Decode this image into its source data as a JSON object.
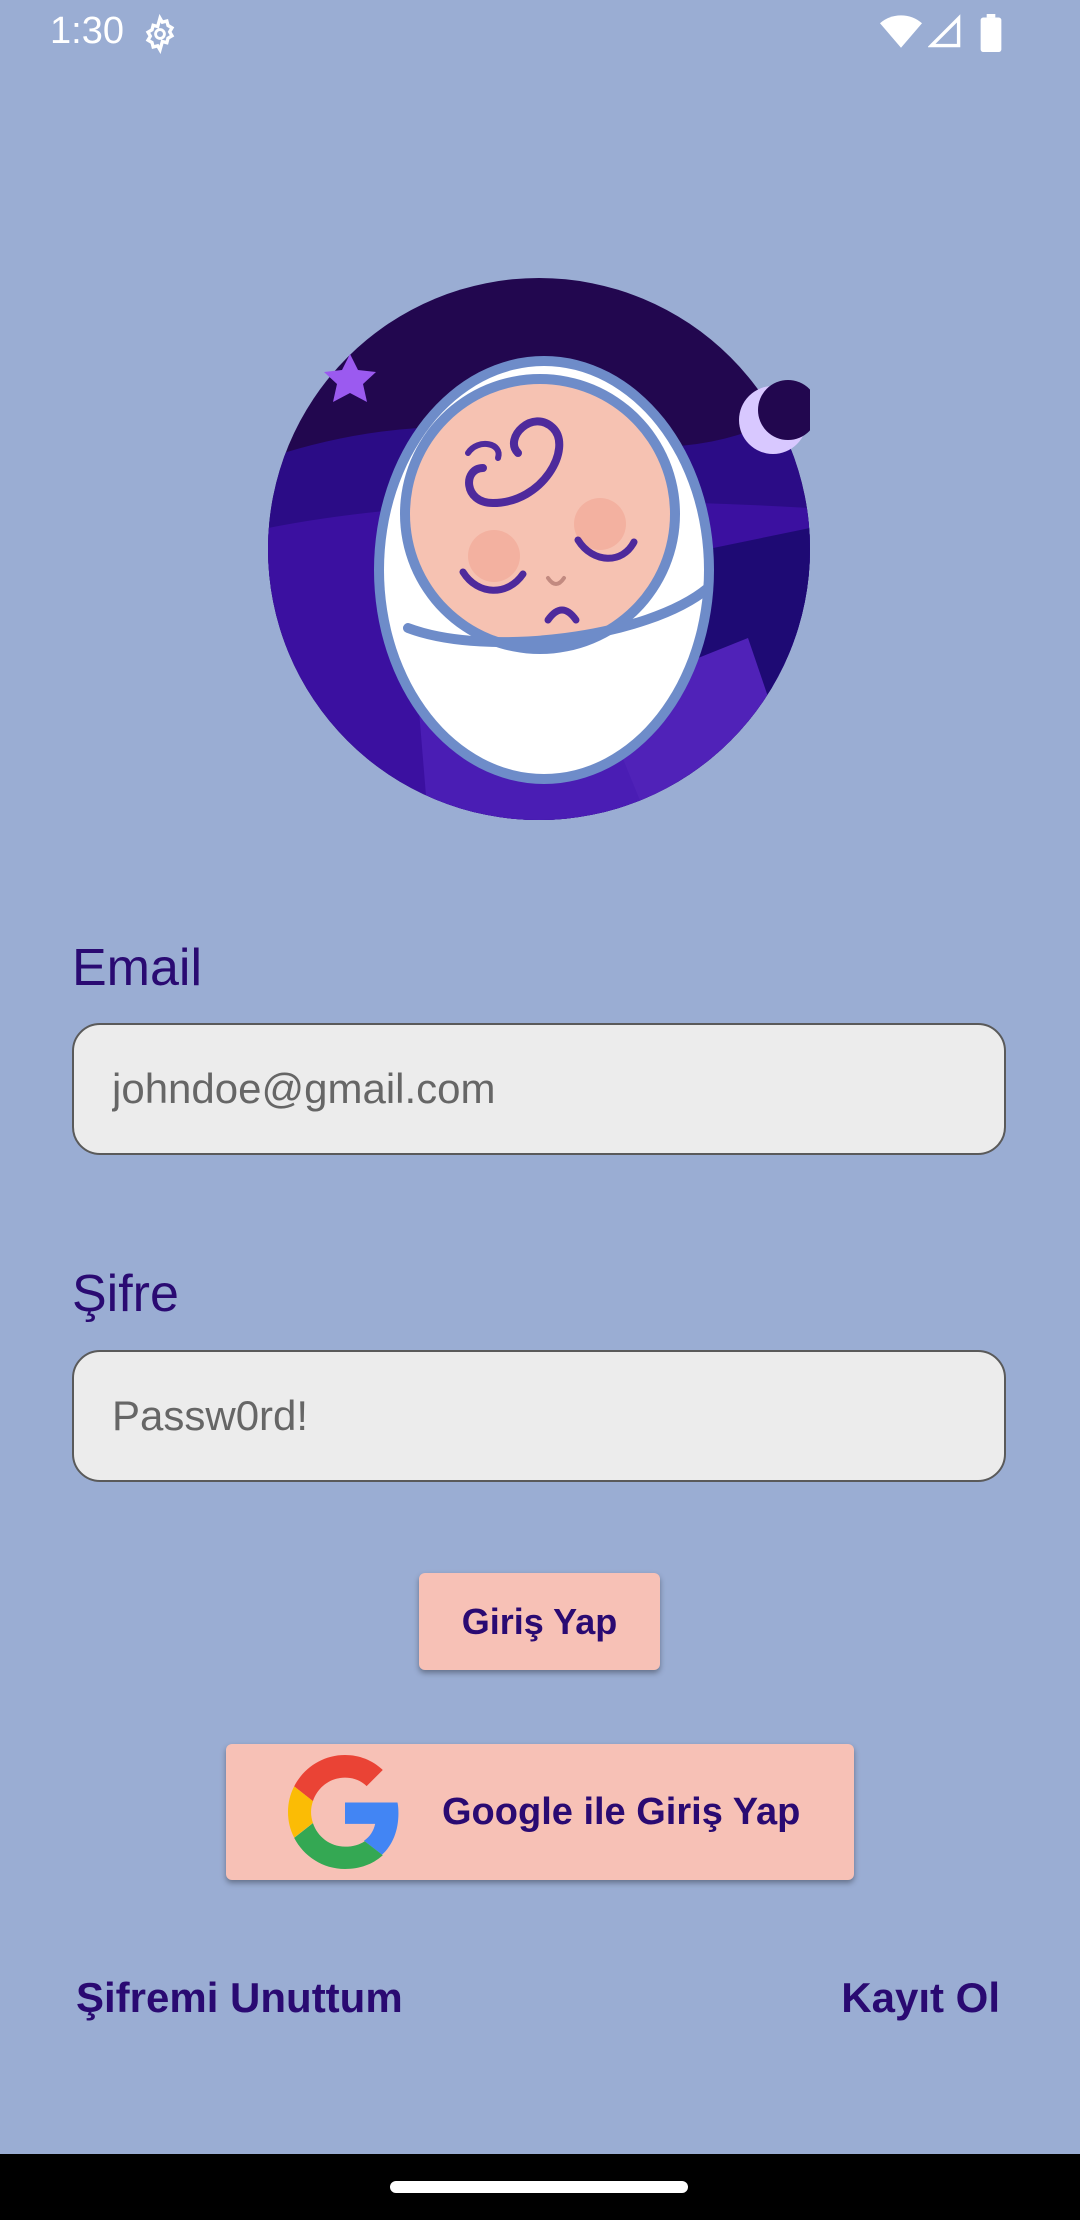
{
  "status_bar": {
    "time": "1:30",
    "icons": [
      "gear-icon",
      "wifi-icon",
      "signal-icon",
      "battery-icon"
    ]
  },
  "logo": {
    "icon": "sleeping-baby-logo"
  },
  "form": {
    "email_label": "Email",
    "email_placeholder": "johndoe@gmail.com",
    "password_label": "Şifre",
    "password_placeholder": "Passw0rd!",
    "login_button": "Giriş Yap",
    "google_button": "Google ile Giriş Yap"
  },
  "links": {
    "forgot_password": "Şifremi Unuttum",
    "register": "Kayıt Ol"
  },
  "colors": {
    "background": "#9aadd3",
    "accent_text": "#2a0a72",
    "button": "#f7c1b6",
    "logo_dark": "#1c0a5e"
  }
}
